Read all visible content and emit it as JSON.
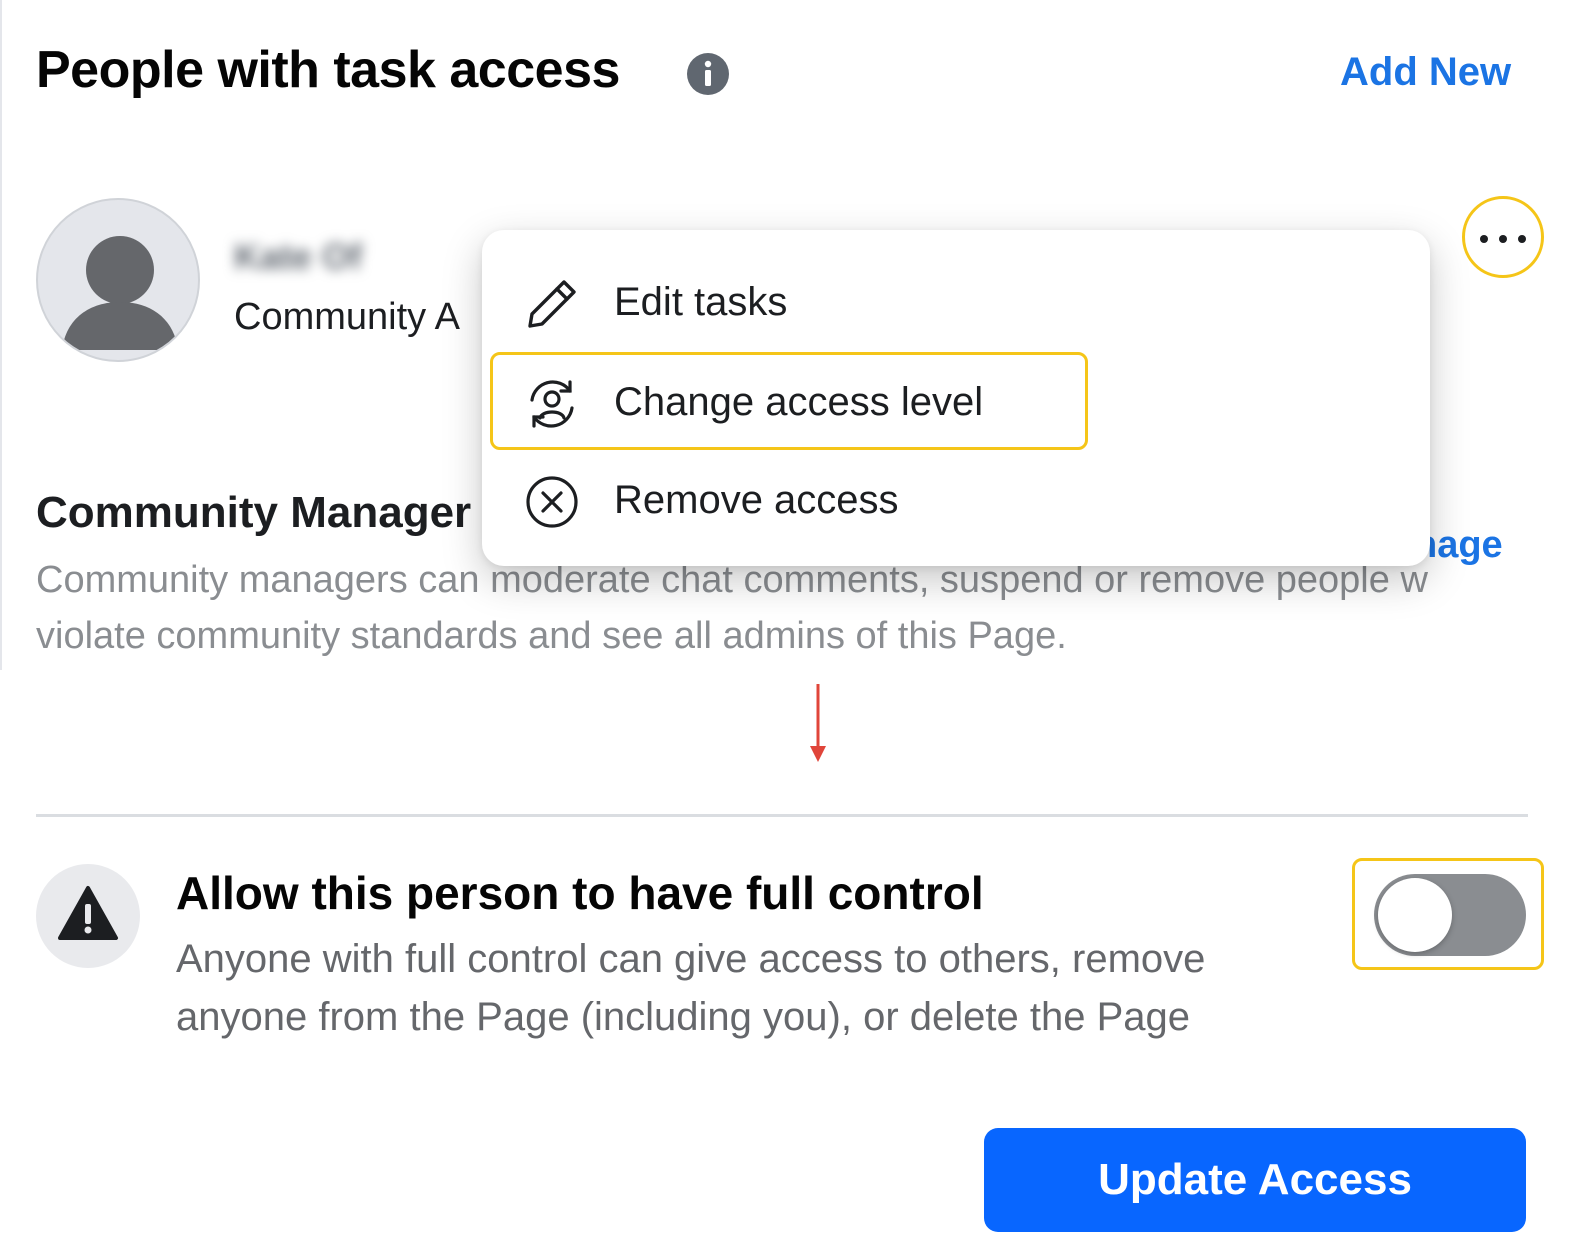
{
  "header": {
    "title": "People with task access",
    "add_new_label": "Add New"
  },
  "person": {
    "name": "Kate Of",
    "role_truncated": "Community A"
  },
  "role_section": {
    "heading_truncated": "Community Manager",
    "manage_link_truncated": "nage",
    "description_lines": [
      "Community managers can moderate chat comments, suspend or remove people w",
      "violate community standards and see all admins of this Page."
    ]
  },
  "menu": {
    "items": [
      {
        "label": "Edit tasks",
        "icon": "pencil-icon"
      },
      {
        "label": "Change access level",
        "icon": "person-circle-arrows-icon"
      },
      {
        "label": "Remove access",
        "icon": "x-circle-icon"
      }
    ]
  },
  "full_control": {
    "title": "Allow this person to have full control",
    "description": "Anyone with full control can give access to others, remove anyone from the Page (including you), or delete the Page",
    "toggle_on": false
  },
  "footer": {
    "update_button_label": "Update Access"
  },
  "colors": {
    "link_blue": "#1b74e4",
    "button_blue": "#0866ff",
    "highlight_yellow": "#f5c518",
    "arrow_red": "#e0453a"
  }
}
